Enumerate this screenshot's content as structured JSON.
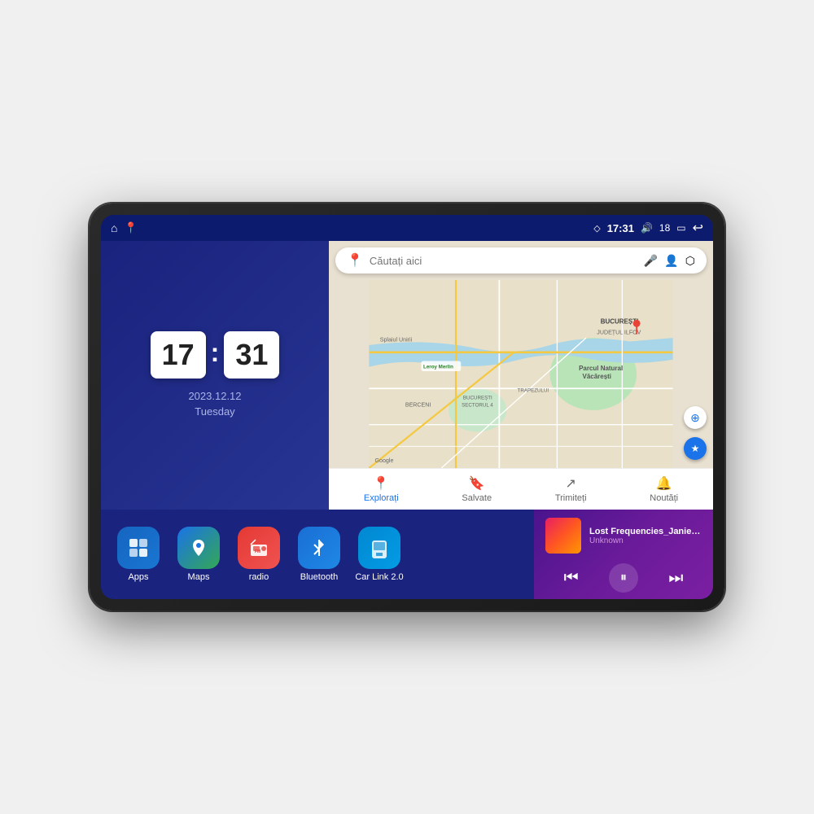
{
  "device": {
    "screen": {
      "status_bar": {
        "left_icons": [
          "home",
          "maps-pin"
        ],
        "time": "17:31",
        "volume_icon": "volume",
        "battery_level": "18",
        "battery_icon": "battery",
        "back_icon": "back"
      },
      "clock": {
        "hour": "17",
        "minute": "31",
        "date": "2023.12.12",
        "day": "Tuesday"
      },
      "map": {
        "search_placeholder": "Căutați aici",
        "location_label": "Parcul Natural Văcărești",
        "area_label": "BUCUREȘTI",
        "area2_label": "JUDEȚUL ILFOV",
        "district_label": "BUCUREȘTI SECTORUL 4",
        "area3_label": "BERCENI",
        "nav_items": [
          {
            "label": "Explorați",
            "active": true
          },
          {
            "label": "Salvate",
            "active": false
          },
          {
            "label": "Trimiteți",
            "active": false
          },
          {
            "label": "Noutăți",
            "active": false
          }
        ]
      },
      "apps": [
        {
          "id": "apps",
          "label": "Apps",
          "icon": "⊞",
          "color_class": "icon-apps"
        },
        {
          "id": "maps",
          "label": "Maps",
          "icon": "📍",
          "color_class": "icon-maps"
        },
        {
          "id": "radio",
          "label": "radio",
          "icon": "📻",
          "color_class": "icon-radio"
        },
        {
          "id": "bluetooth",
          "label": "Bluetooth",
          "icon": "⬡",
          "color_class": "icon-bluetooth"
        },
        {
          "id": "carlink",
          "label": "Car Link 2.0",
          "icon": "📱",
          "color_class": "icon-carlink"
        }
      ],
      "music": {
        "title": "Lost Frequencies_Janieck Devy-...",
        "artist": "Unknown",
        "prev_icon": "⏮",
        "play_icon": "⏸",
        "next_icon": "⏭"
      }
    }
  }
}
